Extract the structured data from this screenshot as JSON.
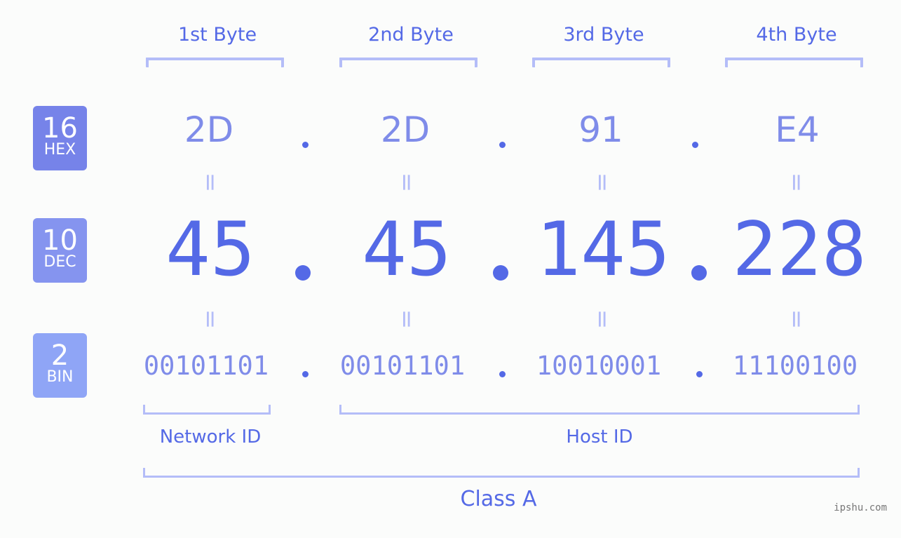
{
  "bytes": [
    {
      "label": "1st Byte",
      "hex": "2D",
      "dec": "45",
      "bin": "00101101"
    },
    {
      "label": "2nd Byte",
      "hex": "2D",
      "dec": "45",
      "bin": "00101101"
    },
    {
      "label": "3rd Byte",
      "hex": "91",
      "dec": "145",
      "bin": "10010001"
    },
    {
      "label": "4th Byte",
      "hex": "E4",
      "dec": "228",
      "bin": "11100100"
    }
  ],
  "badges": {
    "hex": {
      "num": "16",
      "label": "HEX",
      "color": "#7683e9"
    },
    "dec": {
      "num": "10",
      "label": "DEC",
      "color": "#8594ef"
    },
    "bin": {
      "num": "2",
      "label": "BIN",
      "color": "#8fa5f6"
    }
  },
  "separator": ".",
  "equals": "=",
  "groups": {
    "network": "Network ID",
    "host": "Host ID",
    "class": "Class A"
  },
  "watermark": "ipshu.com",
  "colors": {
    "accent": "#5469e6",
    "light": "#7f8ce9",
    "bracket": "#b4bdf8",
    "background": "#fbfcfb"
  }
}
